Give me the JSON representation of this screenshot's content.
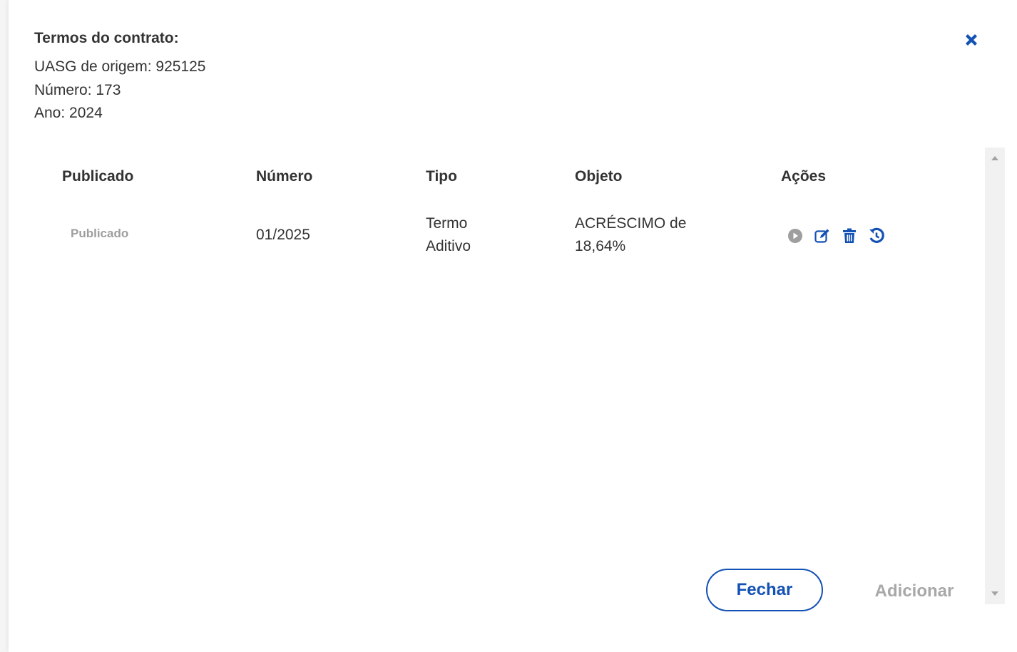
{
  "header": {
    "title": "Termos do contrato:",
    "uasg": "UASG de origem: 925125",
    "numero": "Número: 173",
    "ano": "Ano: 2024"
  },
  "table": {
    "columns": [
      "Publicado",
      "Número",
      "Tipo",
      "Objeto",
      "Ações"
    ],
    "rows": [
      {
        "publicado": "Publicado",
        "numero": "01/2025",
        "tipo_line1": "Termo",
        "tipo_line2": "Aditivo",
        "objeto_line1": "ACRÉSCIMO de",
        "objeto_line2": "18,64%",
        "actions": [
          "play-circle-icon",
          "edit-icon",
          "trash-icon",
          "history-icon"
        ]
      }
    ]
  },
  "buttons": {
    "close_label": "Fechar",
    "add_label": "Adicionar"
  },
  "colors": {
    "primary": "#1351b4",
    "muted": "#9e9e9e",
    "disabled": "#a8a8a8",
    "text": "#333333"
  }
}
